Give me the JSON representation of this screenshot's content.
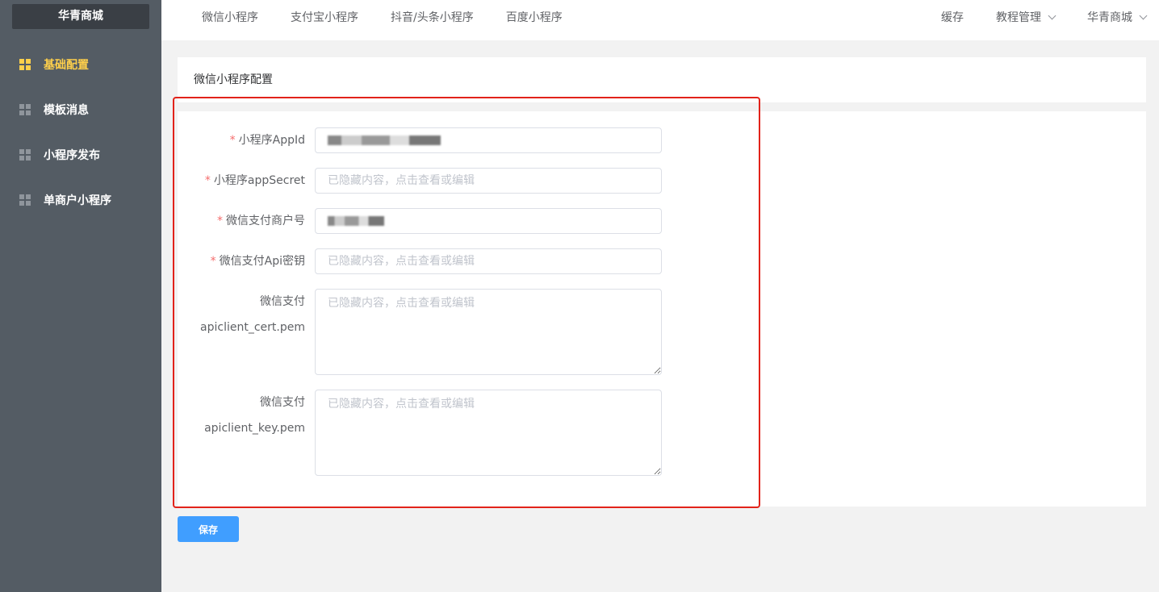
{
  "brand": "华青商城",
  "sidebar": {
    "items": [
      {
        "label": "基础配置",
        "active": true
      },
      {
        "label": "模板消息"
      },
      {
        "label": "小程序发布"
      },
      {
        "label": "单商户小程序"
      }
    ]
  },
  "header": {
    "tabs": [
      "微信小程序",
      "支付宝小程序",
      "抖音/头条小程序",
      "百度小程序"
    ],
    "right": {
      "cache": "缓存",
      "tutorial": "教程管理",
      "store": "华青商城"
    }
  },
  "card": {
    "title": "微信小程序配置"
  },
  "form": {
    "appid": {
      "label": "小程序AppId",
      "required": true
    },
    "secret": {
      "label": "小程序appSecret",
      "required": true,
      "placeholder": "已隐藏内容，点击查看或编辑"
    },
    "mchid": {
      "label": "微信支付商户号",
      "required": true
    },
    "apikey": {
      "label": "微信支付Api密钥",
      "required": true,
      "placeholder": "已隐藏内容，点击查看或编辑"
    },
    "cert": {
      "label_line1": "微信支付",
      "label_line2": "apiclient_cert.pem",
      "placeholder": "已隐藏内容，点击查看或编辑"
    },
    "key": {
      "label_line1": "微信支付",
      "label_line2": "apiclient_key.pem",
      "placeholder": "已隐藏内容，点击查看或编辑"
    }
  },
  "save_label": "保存",
  "colors": {
    "sidebar": "#545c64",
    "active": "#ffd04b",
    "primary": "#409eff",
    "highlight": "#e2231a"
  }
}
